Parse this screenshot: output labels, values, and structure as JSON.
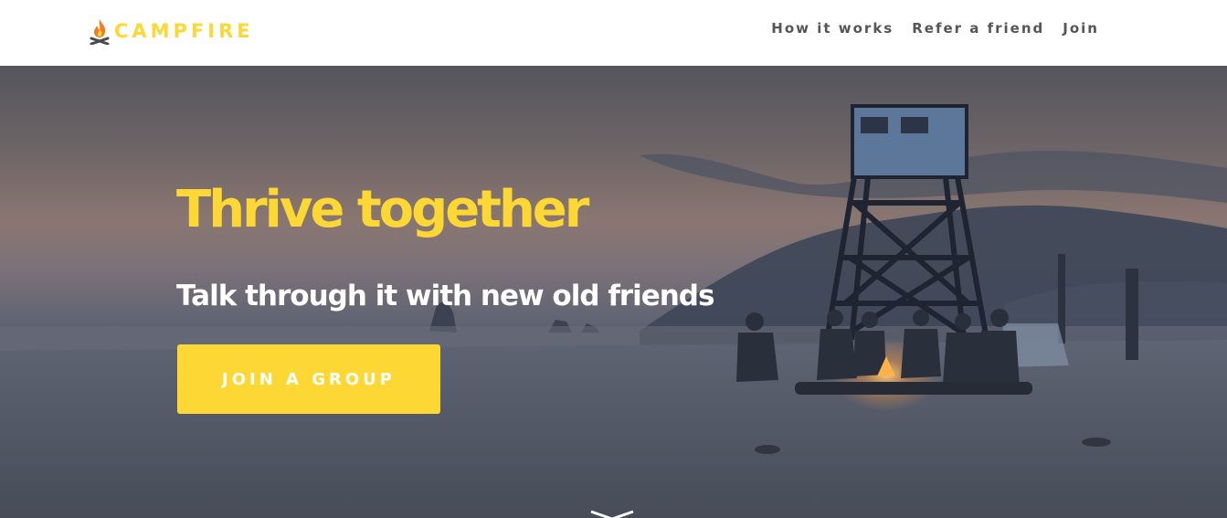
{
  "brand": {
    "name": "CAMPFIRE",
    "logo_icon": "campfire-icon",
    "accent_color": "#fdd835"
  },
  "nav": {
    "items": [
      {
        "label": "How it works"
      },
      {
        "label": "Refer a friend"
      },
      {
        "label": "Join"
      }
    ]
  },
  "hero": {
    "title": "Thrive together",
    "subtitle": "Talk through it with new old friends",
    "cta_label": "JOIN A GROUP",
    "scroll_icon": "chevron-down-icon"
  }
}
